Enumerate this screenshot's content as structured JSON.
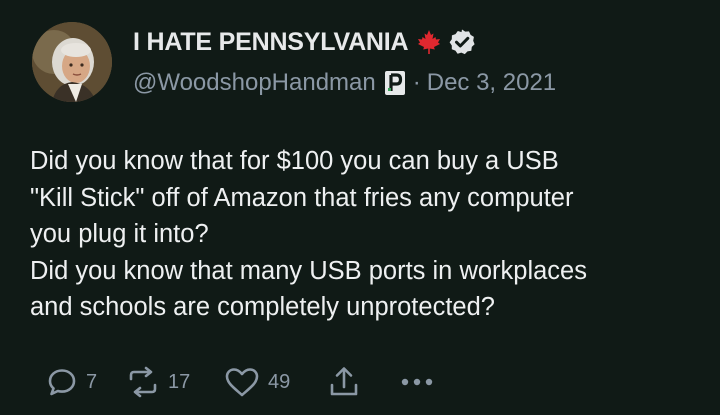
{
  "author": {
    "display_name": "I HATE PENNSYLVANIA",
    "handle": "@WoodshopHandman",
    "date": "Dec 3, 2021",
    "separator": "·"
  },
  "tweet": {
    "lines": [
      "Did you know that for $100 you can buy a USB",
      "\"Kill Stick\" off of Amazon that fries any computer",
      "you plug it into?",
      "Did you know that many USB ports in workplaces",
      "and schools are completely unprotected?"
    ]
  },
  "actions": {
    "replies": "7",
    "reposts": "17",
    "likes": "49"
  },
  "icons": {
    "flag": "maple-leaf-icon",
    "verified": "verified-check-icon",
    "badge": "p-badge-icon",
    "reply": "reply-icon",
    "repost": "repost-icon",
    "like": "heart-icon",
    "share": "share-icon",
    "more": "more-icon"
  },
  "colors": {
    "background": "#101a16",
    "text": "#e7e9ea",
    "muted": "#8b98a5",
    "maple": "#e0282f"
  }
}
